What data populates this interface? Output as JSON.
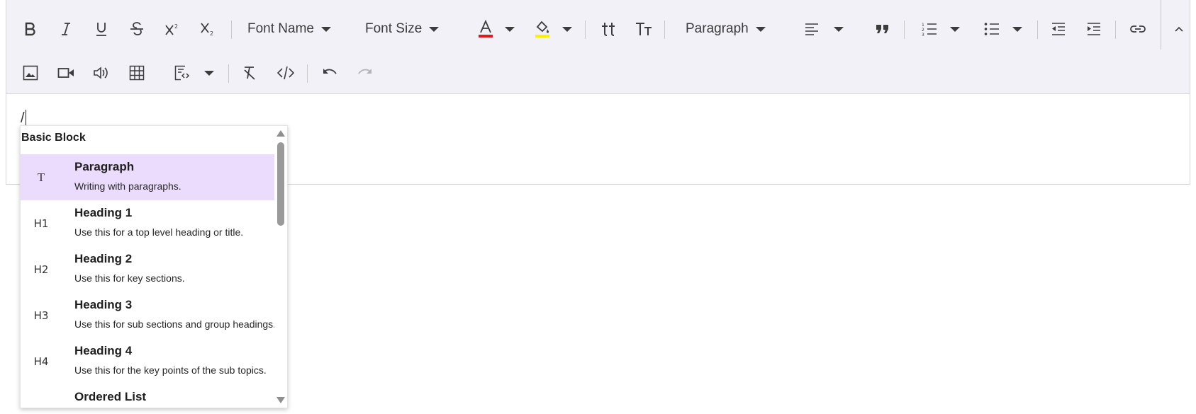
{
  "toolbar": {
    "font_name": "Font Name",
    "font_size": "Font Size",
    "format": "Paragraph",
    "font_color": "#e0191e",
    "background_color": "#ffef00"
  },
  "editor": {
    "typed_text": "/"
  },
  "slash_menu": {
    "group_header": "Basic Block",
    "items": [
      {
        "icon": "T",
        "title": "Paragraph",
        "description": "Writing with paragraphs.",
        "active": true
      },
      {
        "icon": "H1",
        "title": "Heading 1",
        "description": "Use this for a top level heading or title.",
        "active": false
      },
      {
        "icon": "H2",
        "title": "Heading 2",
        "description": "Use this for key sections.",
        "active": false
      },
      {
        "icon": "H3",
        "title": "Heading 3",
        "description": "Use this for sub sections and group headings.",
        "active": false
      },
      {
        "icon": "H4",
        "title": "Heading 4",
        "description": "Use this for the key points of the sub topics.",
        "active": false
      },
      {
        "icon": "ordered-list-icon",
        "title": "Ordered List",
        "description": "",
        "active": false
      }
    ],
    "highlight_color": "#ebdcfd"
  }
}
